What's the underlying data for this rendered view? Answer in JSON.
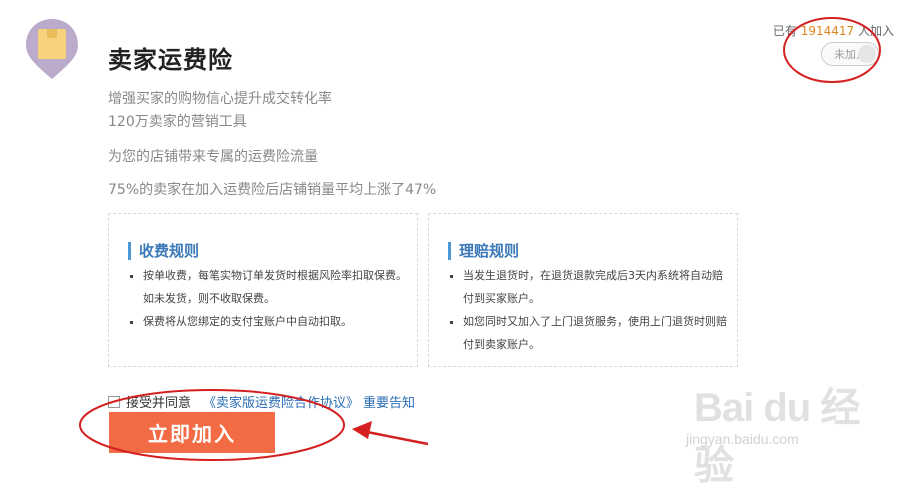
{
  "header": {
    "title": "卖家运费险",
    "desc_lines": [
      "增强买家的购物信心提升成交转化率",
      "120万卖家的营销工具"
    ],
    "traffic_line": "为您的店铺带来专属的运费险流量",
    "stats_line": "75%的卖家在加入运费险后店铺销量平均上涨了47%"
  },
  "joined": {
    "prefix": "已有",
    "count": "1914417",
    "suffix": "人加入",
    "toggle_label": "未加入"
  },
  "fee_rules": {
    "heading": "收费规则",
    "items": [
      "按单收费，每笔实物订单发货时根据风险率扣取保费。如未发货，则不收取保费。",
      "保费将从您绑定的支付宝账户中自动扣取。"
    ]
  },
  "claim_rules": {
    "heading": "理赔规则",
    "items": [
      "当发生退货时，在退货退款完成后3天内系统将自动赔付到买家账户。",
      "如您同时又加入了上门退货服务，使用上门退货时则赔付到卖家账户。"
    ]
  },
  "agreement": {
    "accept_label": "接受并同意",
    "agreement_link": "《卖家版运费险合作协议》",
    "notice_link": "重要告知",
    "checked": false
  },
  "join_button": {
    "label": "立即加入"
  },
  "watermark": {
    "logo": "Bai du 经验",
    "url": "jingyan.baidu.com"
  },
  "colors": {
    "accent": "#f26b45",
    "link": "#2a6cb5",
    "count": "#e0861e",
    "annotation": "#d42020",
    "logo_bg": "#b9a8c9"
  }
}
